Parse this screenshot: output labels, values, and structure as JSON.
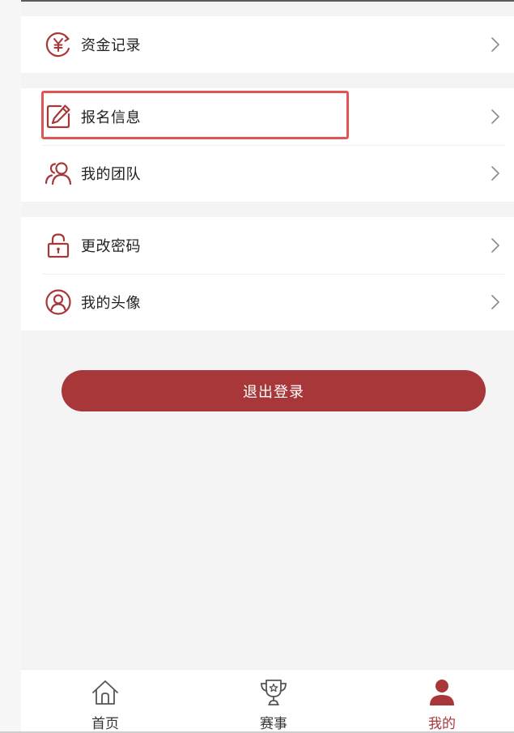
{
  "menu": {
    "funds": {
      "label": "资金记录",
      "icon": "yen-circle-icon"
    },
    "signup": {
      "label": "报名信息",
      "icon": "edit-icon"
    },
    "team": {
      "label": "我的团队",
      "icon": "team-icon"
    },
    "password": {
      "label": "更改密码",
      "icon": "lock-icon"
    },
    "avatar": {
      "label": "我的头像",
      "icon": "user-circle-icon"
    }
  },
  "logout_label": "退出登录",
  "tabs": [
    {
      "label": "首页",
      "icon": "home-icon",
      "active": false
    },
    {
      "label": "赛事",
      "icon": "trophy-icon",
      "active": false
    },
    {
      "label": "我的",
      "icon": "person-icon",
      "active": true
    }
  ],
  "colors": {
    "accent": "#a8373a",
    "highlight": "#e05555",
    "background": "#f4f4f4"
  }
}
